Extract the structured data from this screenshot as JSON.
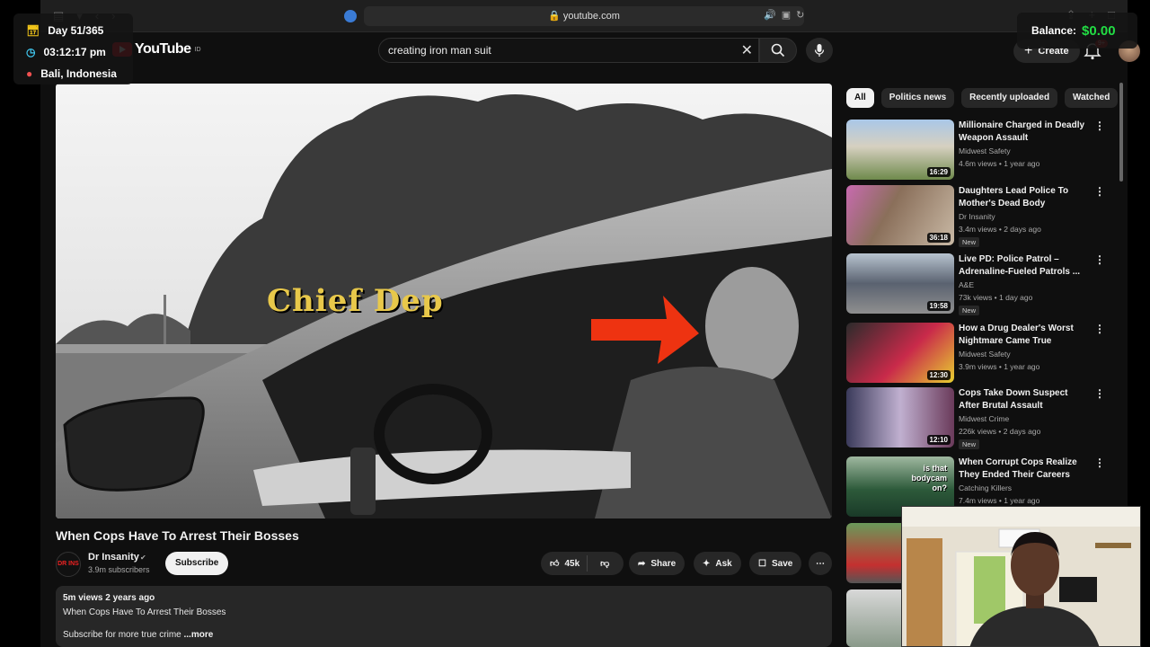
{
  "browser": {
    "url": "youtube.com"
  },
  "header": {
    "logo_text": "YouTube",
    "logo_region": "ID",
    "search_value": "creating iron man suit",
    "create_label": "Create",
    "notification_count": "9+"
  },
  "video": {
    "caption": "Chief Dep",
    "title": "When Cops Have To Arrest Their Bosses",
    "channel": {
      "avatar_text": "DR INS",
      "name": "Dr Insanity",
      "subscribers": "3.9m subscribers"
    },
    "subscribe_label": "Subscribe",
    "likes": "45k",
    "share_label": "Share",
    "ask_label": "Ask",
    "save_label": "Save",
    "description": {
      "meta": "5m views  2 years ago",
      "line1": "When Cops Have To Arrest Their Bosses",
      "line2": "Subscribe for more true crime",
      "more": " ...more"
    }
  },
  "chips": [
    "All",
    "Politics news",
    "Recently uploaded",
    "Watched"
  ],
  "recommendations": [
    {
      "title": "Millionaire Charged in Deadly Weapon Assault",
      "channel": "Midwest Safety",
      "views": "4.6m views • 1 year ago",
      "duration": "16:29",
      "badge": ""
    },
    {
      "title": "Daughters Lead Police To Mother's Dead Body",
      "channel": "Dr Insanity",
      "views": "3.4m views • 2 days ago",
      "duration": "36:18",
      "badge": "New"
    },
    {
      "title": "Live PD: Police Patrol – Adrenaline-Fueled Patrols ...",
      "channel": "A&E",
      "views": "73k views • 1 day ago",
      "duration": "19:58",
      "badge": "New"
    },
    {
      "title": "How a Drug Dealer's Worst Nightmare Came True",
      "channel": "Midwest Safety",
      "views": "3.9m views • 1 year ago",
      "duration": "12:30",
      "badge": ""
    },
    {
      "title": "Cops Take Down Suspect After Brutal Assault",
      "channel": "Midwest Crime",
      "views": "226k views • 2 days ago",
      "duration": "12:10",
      "badge": "New"
    },
    {
      "title": "When Corrupt Cops Realize They Ended Their Careers",
      "channel": "Catching Killers",
      "views": "7.4m views • 1 year ago",
      "duration": "",
      "badge": "",
      "thumb_text": "is that bodycam on?"
    }
  ],
  "overlay": {
    "day": "Day 51/365",
    "time": "03:12:17 pm",
    "location": "Bali, Indonesia",
    "balance_label": "Balance:",
    "balance_value": "$0.00"
  },
  "colors": {
    "balance_green": "#22dd44",
    "yt_red": "#ee1111",
    "arrow_red": "#ee3311"
  }
}
